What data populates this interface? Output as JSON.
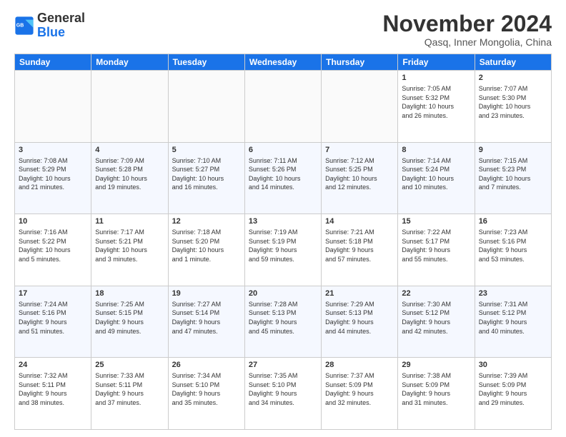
{
  "header": {
    "logo": {
      "line1": "General",
      "line2": "Blue"
    },
    "title": "November 2024",
    "location": "Qasq, Inner Mongolia, China"
  },
  "weekdays": [
    "Sunday",
    "Monday",
    "Tuesday",
    "Wednesday",
    "Thursday",
    "Friday",
    "Saturday"
  ],
  "weeks": [
    [
      {
        "day": "",
        "info": ""
      },
      {
        "day": "",
        "info": ""
      },
      {
        "day": "",
        "info": ""
      },
      {
        "day": "",
        "info": ""
      },
      {
        "day": "",
        "info": ""
      },
      {
        "day": "1",
        "info": "Sunrise: 7:05 AM\nSunset: 5:32 PM\nDaylight: 10 hours\nand 26 minutes."
      },
      {
        "day": "2",
        "info": "Sunrise: 7:07 AM\nSunset: 5:30 PM\nDaylight: 10 hours\nand 23 minutes."
      }
    ],
    [
      {
        "day": "3",
        "info": "Sunrise: 7:08 AM\nSunset: 5:29 PM\nDaylight: 10 hours\nand 21 minutes."
      },
      {
        "day": "4",
        "info": "Sunrise: 7:09 AM\nSunset: 5:28 PM\nDaylight: 10 hours\nand 19 minutes."
      },
      {
        "day": "5",
        "info": "Sunrise: 7:10 AM\nSunset: 5:27 PM\nDaylight: 10 hours\nand 16 minutes."
      },
      {
        "day": "6",
        "info": "Sunrise: 7:11 AM\nSunset: 5:26 PM\nDaylight: 10 hours\nand 14 minutes."
      },
      {
        "day": "7",
        "info": "Sunrise: 7:12 AM\nSunset: 5:25 PM\nDaylight: 10 hours\nand 12 minutes."
      },
      {
        "day": "8",
        "info": "Sunrise: 7:14 AM\nSunset: 5:24 PM\nDaylight: 10 hours\nand 10 minutes."
      },
      {
        "day": "9",
        "info": "Sunrise: 7:15 AM\nSunset: 5:23 PM\nDaylight: 10 hours\nand 7 minutes."
      }
    ],
    [
      {
        "day": "10",
        "info": "Sunrise: 7:16 AM\nSunset: 5:22 PM\nDaylight: 10 hours\nand 5 minutes."
      },
      {
        "day": "11",
        "info": "Sunrise: 7:17 AM\nSunset: 5:21 PM\nDaylight: 10 hours\nand 3 minutes."
      },
      {
        "day": "12",
        "info": "Sunrise: 7:18 AM\nSunset: 5:20 PM\nDaylight: 10 hours\nand 1 minute."
      },
      {
        "day": "13",
        "info": "Sunrise: 7:19 AM\nSunset: 5:19 PM\nDaylight: 9 hours\nand 59 minutes."
      },
      {
        "day": "14",
        "info": "Sunrise: 7:21 AM\nSunset: 5:18 PM\nDaylight: 9 hours\nand 57 minutes."
      },
      {
        "day": "15",
        "info": "Sunrise: 7:22 AM\nSunset: 5:17 PM\nDaylight: 9 hours\nand 55 minutes."
      },
      {
        "day": "16",
        "info": "Sunrise: 7:23 AM\nSunset: 5:16 PM\nDaylight: 9 hours\nand 53 minutes."
      }
    ],
    [
      {
        "day": "17",
        "info": "Sunrise: 7:24 AM\nSunset: 5:16 PM\nDaylight: 9 hours\nand 51 minutes."
      },
      {
        "day": "18",
        "info": "Sunrise: 7:25 AM\nSunset: 5:15 PM\nDaylight: 9 hours\nand 49 minutes."
      },
      {
        "day": "19",
        "info": "Sunrise: 7:27 AM\nSunset: 5:14 PM\nDaylight: 9 hours\nand 47 minutes."
      },
      {
        "day": "20",
        "info": "Sunrise: 7:28 AM\nSunset: 5:13 PM\nDaylight: 9 hours\nand 45 minutes."
      },
      {
        "day": "21",
        "info": "Sunrise: 7:29 AM\nSunset: 5:13 PM\nDaylight: 9 hours\nand 44 minutes."
      },
      {
        "day": "22",
        "info": "Sunrise: 7:30 AM\nSunset: 5:12 PM\nDaylight: 9 hours\nand 42 minutes."
      },
      {
        "day": "23",
        "info": "Sunrise: 7:31 AM\nSunset: 5:12 PM\nDaylight: 9 hours\nand 40 minutes."
      }
    ],
    [
      {
        "day": "24",
        "info": "Sunrise: 7:32 AM\nSunset: 5:11 PM\nDaylight: 9 hours\nand 38 minutes."
      },
      {
        "day": "25",
        "info": "Sunrise: 7:33 AM\nSunset: 5:11 PM\nDaylight: 9 hours\nand 37 minutes."
      },
      {
        "day": "26",
        "info": "Sunrise: 7:34 AM\nSunset: 5:10 PM\nDaylight: 9 hours\nand 35 minutes."
      },
      {
        "day": "27",
        "info": "Sunrise: 7:35 AM\nSunset: 5:10 PM\nDaylight: 9 hours\nand 34 minutes."
      },
      {
        "day": "28",
        "info": "Sunrise: 7:37 AM\nSunset: 5:09 PM\nDaylight: 9 hours\nand 32 minutes."
      },
      {
        "day": "29",
        "info": "Sunrise: 7:38 AM\nSunset: 5:09 PM\nDaylight: 9 hours\nand 31 minutes."
      },
      {
        "day": "30",
        "info": "Sunrise: 7:39 AM\nSunset: 5:09 PM\nDaylight: 9 hours\nand 29 minutes."
      }
    ]
  ]
}
